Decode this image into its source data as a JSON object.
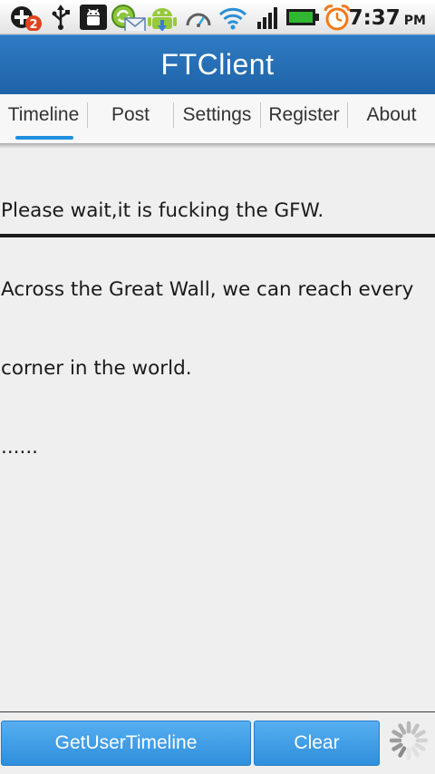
{
  "status_bar": {
    "time": "7:37",
    "ampm": "PM",
    "notification_badge": "2",
    "icons": [
      "plus-notification-icon",
      "usb-icon",
      "android-debug-icon",
      "email-sync-icon",
      "android-download-icon",
      "speed-gauge-icon",
      "wifi-icon",
      "signal-icon",
      "battery-icon",
      "alarm-clock-icon"
    ],
    "colors": {
      "battery": "#2fb82f",
      "alarm": "#f07a1a",
      "badge": "#e0441f"
    }
  },
  "app": {
    "title": "FTClient",
    "colors": {
      "title_bar": "#2a72ba",
      "tab_indicator": "#1f8fe0",
      "button": "#3d9be6"
    }
  },
  "tabs": [
    {
      "label": "Timeline",
      "active": true
    },
    {
      "label": "Post",
      "active": false
    },
    {
      "label": "Settings",
      "active": false
    },
    {
      "label": "Register",
      "active": false
    },
    {
      "label": "About",
      "active": false
    }
  ],
  "content": {
    "lines": [
      "Please wait,it is fucking the GFW.",
      "Across the Great Wall, we can reach every",
      "corner in the world.",
      "......"
    ]
  },
  "actions": {
    "get_timeline_label": "GetUserTimeline",
    "clear_label": "Clear"
  }
}
